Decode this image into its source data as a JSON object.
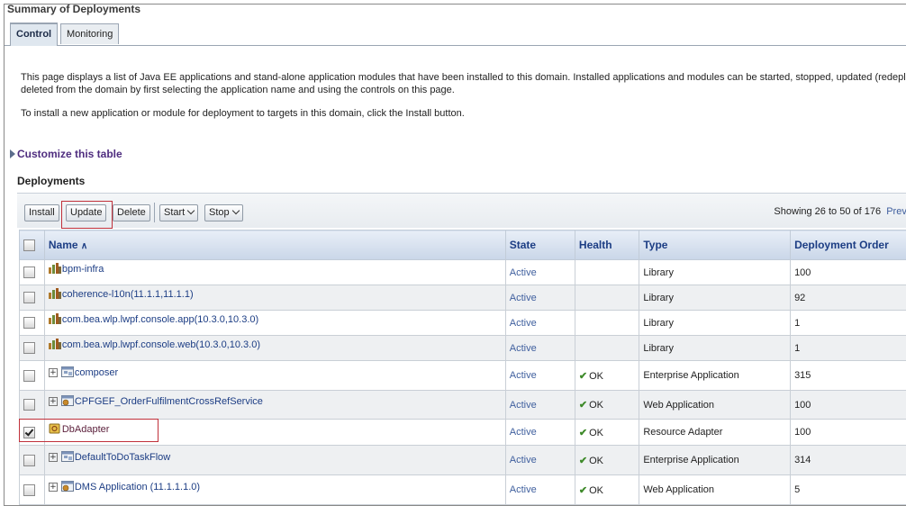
{
  "page": {
    "summary_title": "Summary of Deployments",
    "tabs": [
      {
        "label": "Control"
      },
      {
        "label": "Monitoring"
      }
    ],
    "description_1": "This page displays a list of Java EE applications and stand-alone application modules that have been installed to this domain. Installed applications and modules can be started, stopped, updated (redeployed),",
    "description_2": "deleted from the domain by first selecting the application name and using the controls on this page.",
    "description_3": "To install a new application or module for deployment to targets in this domain, click the Install button.",
    "customize_label": "Customize this table",
    "section_title": "Deployments"
  },
  "toolbar": {
    "install": "Install",
    "update": "Update",
    "delete": "Delete",
    "start": "Start",
    "stop": "Stop",
    "showing": "Showing 26 to 50 of 176",
    "previous": "Previous"
  },
  "table": {
    "headers": {
      "name": "Name",
      "state": "State",
      "health": "Health",
      "type": "Type",
      "order": "Deployment Order"
    },
    "rows": [
      {
        "name": "bpm-infra",
        "state": "Active",
        "health": "",
        "type": "Library",
        "order": "100",
        "icon": "library-icon",
        "expand": false,
        "checked": false
      },
      {
        "name": "coherence-l10n(11.1.1,11.1.1)",
        "state": "Active",
        "health": "",
        "type": "Library",
        "order": "92",
        "icon": "library-icon",
        "expand": false,
        "checked": false
      },
      {
        "name": "com.bea.wlp.lwpf.console.app(10.3.0,10.3.0)",
        "state": "Active",
        "health": "",
        "type": "Library",
        "order": "1",
        "icon": "library-icon",
        "expand": false,
        "checked": false
      },
      {
        "name": "com.bea.wlp.lwpf.console.web(10.3.0,10.3.0)",
        "state": "Active",
        "health": "",
        "type": "Library",
        "order": "1",
        "icon": "library-icon",
        "expand": false,
        "checked": false
      },
      {
        "name": "composer",
        "state": "Active",
        "health": "OK",
        "type": "Enterprise Application",
        "order": "315",
        "icon": "enterprise-app-icon",
        "expand": true,
        "checked": false
      },
      {
        "name": "CPFGEF_OrderFulfilmentCrossRefService",
        "state": "Active",
        "health": "OK",
        "type": "Web Application",
        "order": "100",
        "icon": "web-app-icon",
        "expand": true,
        "checked": false
      },
      {
        "name": "DbAdapter",
        "state": "Active",
        "health": "OK",
        "type": "Resource Adapter",
        "order": "100",
        "icon": "resource-adapter-icon",
        "expand": false,
        "checked": true
      },
      {
        "name": "DefaultToDoTaskFlow",
        "state": "Active",
        "health": "OK",
        "type": "Enterprise Application",
        "order": "314",
        "icon": "enterprise-app-icon",
        "expand": true,
        "checked": false
      },
      {
        "name": "DMS Application (11.1.1.1.0)",
        "state": "Active",
        "health": "OK",
        "type": "Web Application",
        "order": "5",
        "icon": "web-app-icon",
        "expand": true,
        "checked": false
      }
    ]
  },
  "colors": {
    "highlight_border": "#c0303a",
    "header_text": "#1c3d84",
    "ok_check": "#3e8a2a"
  }
}
